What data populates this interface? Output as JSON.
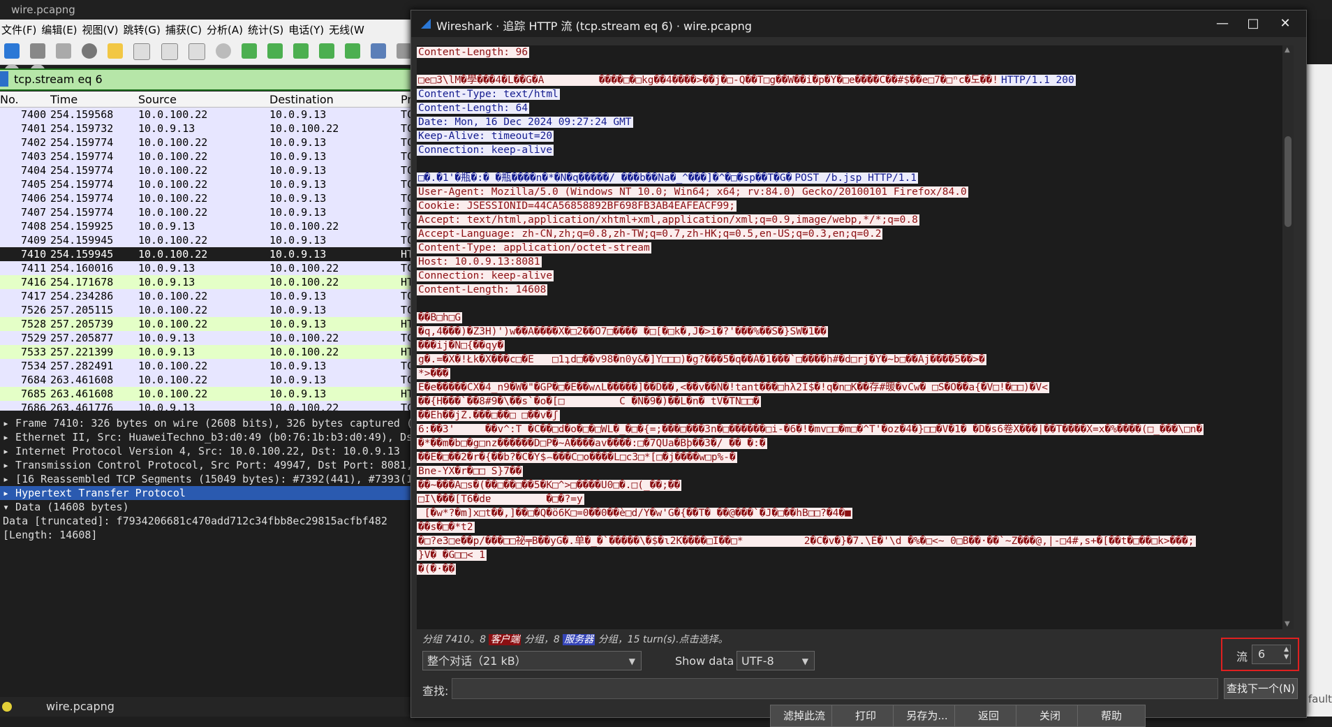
{
  "bg_window": {
    "title": "wire.pcapng",
    "menu": [
      "文件(F)",
      "编辑(E)",
      "视图(V)",
      "跳转(G)",
      "捕获(C)",
      "分析(A)",
      "统计(S)",
      "电话(Y)",
      "无线(W"
    ],
    "filter": "tcp.stream eq 6",
    "columns": {
      "no": "No.",
      "time": "Time",
      "source": "Source",
      "destination": "Destination",
      "protocol": "Pr"
    },
    "packets": [
      {
        "no": "7400",
        "time": "254.159568",
        "src": "10.0.100.22",
        "dst": "10.0.9.13",
        "proto": "TC",
        "kind": "tcp"
      },
      {
        "no": "7401",
        "time": "254.159732",
        "src": "10.0.9.13",
        "dst": "10.0.100.22",
        "proto": "TC",
        "kind": "tcp"
      },
      {
        "no": "7402",
        "time": "254.159774",
        "src": "10.0.100.22",
        "dst": "10.0.9.13",
        "proto": "TC",
        "kind": "tcp"
      },
      {
        "no": "7403",
        "time": "254.159774",
        "src": "10.0.100.22",
        "dst": "10.0.9.13",
        "proto": "TC",
        "kind": "tcp"
      },
      {
        "no": "7404",
        "time": "254.159774",
        "src": "10.0.100.22",
        "dst": "10.0.9.13",
        "proto": "TC",
        "kind": "tcp"
      },
      {
        "no": "7405",
        "time": "254.159774",
        "src": "10.0.100.22",
        "dst": "10.0.9.13",
        "proto": "TC",
        "kind": "tcp"
      },
      {
        "no": "7406",
        "time": "254.159774",
        "src": "10.0.100.22",
        "dst": "10.0.9.13",
        "proto": "TC",
        "kind": "tcp"
      },
      {
        "no": "7407",
        "time": "254.159774",
        "src": "10.0.100.22",
        "dst": "10.0.9.13",
        "proto": "TC",
        "kind": "tcp"
      },
      {
        "no": "7408",
        "time": "254.159925",
        "src": "10.0.9.13",
        "dst": "10.0.100.22",
        "proto": "TC",
        "kind": "tcp"
      },
      {
        "no": "7409",
        "time": "254.159945",
        "src": "10.0.100.22",
        "dst": "10.0.9.13",
        "proto": "TC",
        "kind": "tcp"
      },
      {
        "no": "7410",
        "time": "254.159945",
        "src": "10.0.100.22",
        "dst": "10.0.9.13",
        "proto": "HT",
        "kind": "sel"
      },
      {
        "no": "7411",
        "time": "254.160016",
        "src": "10.0.9.13",
        "dst": "10.0.100.22",
        "proto": "TC",
        "kind": "tcp"
      },
      {
        "no": "7416",
        "time": "254.171678",
        "src": "10.0.9.13",
        "dst": "10.0.100.22",
        "proto": "HT",
        "kind": "http"
      },
      {
        "no": "7417",
        "time": "254.234286",
        "src": "10.0.100.22",
        "dst": "10.0.9.13",
        "proto": "TC",
        "kind": "tcp"
      },
      {
        "no": "7526",
        "time": "257.205115",
        "src": "10.0.100.22",
        "dst": "10.0.9.13",
        "proto": "TC",
        "kind": "tcp"
      },
      {
        "no": "7528",
        "time": "257.205739",
        "src": "10.0.100.22",
        "dst": "10.0.9.13",
        "proto": "HT",
        "kind": "http"
      },
      {
        "no": "7529",
        "time": "257.205877",
        "src": "10.0.9.13",
        "dst": "10.0.100.22",
        "proto": "TC",
        "kind": "tcp"
      },
      {
        "no": "7533",
        "time": "257.221399",
        "src": "10.0.9.13",
        "dst": "10.0.100.22",
        "proto": "HT",
        "kind": "http"
      },
      {
        "no": "7534",
        "time": "257.282491",
        "src": "10.0.100.22",
        "dst": "10.0.9.13",
        "proto": "TC",
        "kind": "tcp"
      },
      {
        "no": "7684",
        "time": "263.461608",
        "src": "10.0.100.22",
        "dst": "10.0.9.13",
        "proto": "TC",
        "kind": "tcp"
      },
      {
        "no": "7685",
        "time": "263.461608",
        "src": "10.0.100.22",
        "dst": "10.0.9.13",
        "proto": "HT",
        "kind": "http"
      },
      {
        "no": "7686",
        "time": "263.461776",
        "src": "10.0.9.13",
        "dst": "10.0.100.22",
        "proto": "TC",
        "kind": "tcp"
      }
    ],
    "details": [
      {
        "text": "▸ Frame 7410: 326 bytes on wire (2608 bits), 326 bytes captured (2",
        "hl": false
      },
      {
        "text": "▸ Ethernet II, Src: HuaweiTechno_b3:d0:49 (b0:76:1b:b3:d0:49), Dst",
        "hl": false
      },
      {
        "text": "▸ Internet Protocol Version 4, Src: 10.0.100.22, Dst: 10.0.9.13",
        "hl": false
      },
      {
        "text": "▸ Transmission Control Protocol, Src Port: 49947, Dst Port: 8081,",
        "hl": false
      },
      {
        "text": "▸ [16 Reassembled TCP Segments (15049 bytes): #7392(441), #7393(10",
        "hl": false
      },
      {
        "text": "▸ Hypertext Transfer Protocol",
        "hl": true
      },
      {
        "text": "▾ Data (14608 bytes)",
        "hl": false
      },
      {
        "text": "     Data [truncated]: f7934206681c470add712c34fbb8ec29815acfbf482",
        "hl": false
      },
      {
        "text": "     [Length: 14608]",
        "hl": false
      }
    ],
    "status_file": "wire.pcapng",
    "right_edge_text": "fault"
  },
  "dialog": {
    "title": "Wireshark · 追踪 HTTP 流 (tcp.stream eq 6) · wire.pcapng",
    "lines": [
      {
        "t": "Content-Length: 96",
        "d": "c"
      },
      {
        "t": "",
        "d": "gap"
      },
      {
        "t": "□e□3\\lM�學���4�L��G�A         ����□�□kg��4����>��j�□-Q��T□g��W��i�p�Y�□e����C��#$��e□7�□ⁿc�도��!",
        "d": "c",
        "tail": "HTTP/1.1 200"
      },
      {
        "t": "Content-Type: text/html",
        "d": "s"
      },
      {
        "t": "Content-Length: 64",
        "d": "s"
      },
      {
        "t": "Date: Mon, 16 Dec 2024 09:27:24 GMT",
        "d": "s"
      },
      {
        "t": "Keep-Alive: timeout=20",
        "d": "s"
      },
      {
        "t": "Connection: keep-alive",
        "d": "s"
      },
      {
        "t": "",
        "d": "gap"
      },
      {
        "t": "□�.�1'�瓶�:� �瓶����n�*�N�q�����∕ ���b��Na�_^���]�^�□�sp��T�G�",
        "d": "s",
        "tail": "POST /b.jsp HTTP/1.1"
      },
      {
        "t": "User-Agent: Mozilla/5.0 (Windows NT 10.0; Win64; x64; rv:84.0) Gecko/20100101 Firefox/84.0",
        "d": "c"
      },
      {
        "t": "Cookie: JSESSIONID=44CA56858892BF698FB3AB4EAFEACF99;",
        "d": "c"
      },
      {
        "t": "Accept: text/html,application/xhtml+xml,application/xml;q=0.9,image/webp,*/*;q=0.8",
        "d": "c"
      },
      {
        "t": "Accept-Language: zh-CN,zh;q=0.8,zh-TW;q=0.7,zh-HK;q=0.5,en-US;q=0.3,en;q=0.2",
        "d": "c"
      },
      {
        "t": "Content-Type: application/octet-stream",
        "d": "c"
      },
      {
        "t": "Host: 10.0.9.13:8081",
        "d": "c"
      },
      {
        "t": "Connection: keep-alive",
        "d": "c"
      },
      {
        "t": "Content-Length: 14608",
        "d": "c"
      },
      {
        "t": "",
        "d": "gap"
      },
      {
        "t": "��B□h□G",
        "d": "c"
      },
      {
        "t": "�q,4���)�Z3H)')w��A����X�□2��O7□���� �□[�□k�,J�>i�?'���%��S�}SW�1��",
        "d": "c"
      },
      {
        "t": "���ij�N□{��qy�",
        "d": "c"
      },
      {
        "t": "g�.=�X�!Łk�X���c□�E   □1ʇd□��v98�n0y&�]Y□□□)�g?���5�q��Á�1���`□����h#�d□rj�Y�~b□��Aj����5��>�",
        "d": "c"
      },
      {
        "t": "*>���",
        "d": "c"
      },
      {
        "t": "E�e�����CX�4_n9�W�\"�GP�□�E��wʌL�����]��D��,<��v��N�!tant���□hλ2I$�!q�n□K��存#暖�vCw� □S�O��a{�V□!�□□)�V<",
        "d": "c"
      },
      {
        "t": "��{H���`��8#9�\\��s`�o�[□         C �N�9�)��L�n� tV�TN□□�",
        "d": "c"
      },
      {
        "t": "��Eh��jŻ.���□��□ □��v�ʃ",
        "d": "c"
      },
      {
        "t": "6:��3'     ��v^:T �C��□d�o�□�□WL�_�□�{=;���□���3n�□������□i-�6�!�mv□□�m□�^T'�oz�4�}□□�V�1� �D�s6卷X���|��T����X=x�%����(□_���\\□n�",
        "d": "c"
      },
      {
        "t": "�*��m�b□�g□nz������D□P�~A����av����:□�7QUa�Bþ��3�/ �� �:�",
        "d": "c"
      },
      {
        "t": "��E�□��2�r�{��b?�C�Y$⌢���C□o����L□c3□*[□�j����w□p%-�",
        "d": "c"
      },
      {
        "t": "Bne-YX�r�□□ S}7��",
        "d": "c"
      },
      {
        "t": "��~���A□s�(��□��□��5�K□^>□����U0□�.□(_��;��",
        "d": "c"
      },
      {
        "t": "□I\\���[T6�dɐ         �□�?=y",
        "d": "c"
      },
      {
        "t": " [�w*?�m]x□t��,]��□�Q�ö6K□=0��0��è□d/Y�w'G�{��T� ��@���`�J�□��hB□□?�4�■",
        "d": "c"
      },
      {
        "t": "��s�□�*t2",
        "d": "c"
      },
      {
        "t": "�□?e3□e��p/���□□祕╤B��yG�.单�_�`�����\\�$�ɩ2K����□I��□*          2�C�v�}�7.\\È�'\\d �%�□<~ 0□B��·��`~Z���@,|-□4#,s+�[��t�□��□k>���;",
        "d": "c"
      },
      {
        "t": "}V� �G□□< 1",
        "d": "c"
      },
      {
        "t": "�(�·��",
        "d": "c"
      }
    ],
    "info": {
      "prefix": "分组 7410。8 ",
      "client_label": "客户端",
      "mid": " 分组，8 ",
      "server_label": "服务器",
      "suffix": " 分组，15 turn(s).点击选择。"
    },
    "conversation_select": "整个对话（21 kB）",
    "show_data_label": "Show data as",
    "show_data_value": "UTF-8",
    "stream_label": "流",
    "stream_value": "6",
    "find_label": "查找:",
    "find_value": "",
    "find_next": "查找下一个(N)",
    "buttons": [
      "滤掉此流",
      "打印",
      "另存为...",
      "返回",
      "关闭",
      "帮助"
    ]
  }
}
